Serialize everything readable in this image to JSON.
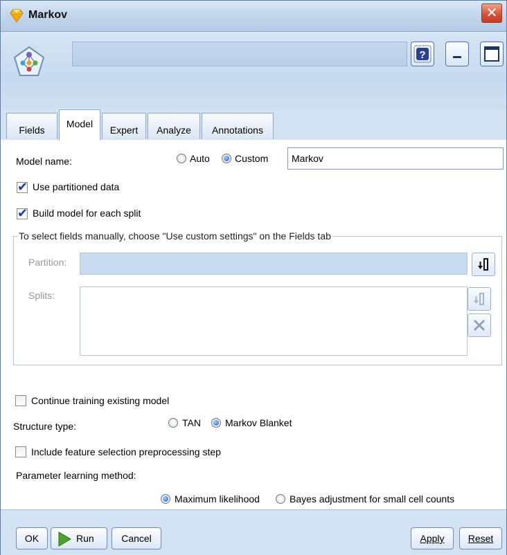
{
  "window": {
    "title": "Markov",
    "app_icon": "gem-icon",
    "close_icon": "close-x-icon"
  },
  "header": {
    "node_icon": "bayesian-network-icon",
    "help_icon": "question-icon"
  },
  "tabs": [
    {
      "label": "Fields"
    },
    {
      "label": "Model"
    },
    {
      "label": "Expert"
    },
    {
      "label": "Analyze"
    },
    {
      "label": "Annotations"
    }
  ],
  "active_tab": "Model",
  "model": {
    "name_label": "Model name:",
    "auto_label": "Auto",
    "custom_label": "Custom",
    "name_value": "Markov",
    "use_partitioned": "Use partitioned data",
    "build_each_split": "Build model for each split",
    "group_title": "To select fields manually, choose \"Use custom settings\" on the Fields tab",
    "partition_label": "Partition:",
    "splits_label": "Splits:",
    "continue_training": "Continue training existing model",
    "structure_label": "Structure type:",
    "tan_label": "TAN",
    "markov_blanket_label": "Markov Blanket",
    "feature_selection": "Include feature selection preprocessing step",
    "param_label": "Parameter learning method:",
    "max_likelihood_label": "Maximum likelihood",
    "bayes_adjust_label": "Bayes adjustment for small cell counts"
  },
  "buttons": {
    "ok": "OK",
    "run": "Run",
    "cancel": "Cancel",
    "apply": "Apply",
    "reset": "Reset"
  }
}
